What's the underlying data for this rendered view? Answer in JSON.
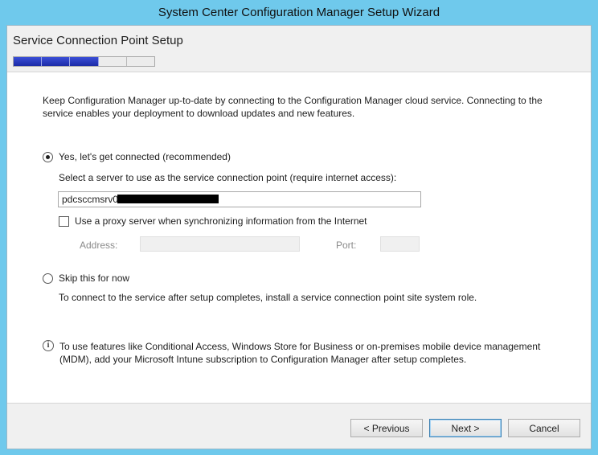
{
  "window": {
    "title": "System Center Configuration Manager Setup Wizard"
  },
  "header": {
    "title": "Service Connection Point Setup",
    "progress": {
      "completed_steps": 3,
      "total_steps": 5
    }
  },
  "main": {
    "intro": "Keep Configuration Manager up-to-date by connecting to the Configuration Manager cloud service. Connecting to the service enables your deployment to download updates and new features.",
    "option_connect": {
      "label": "Yes, let's get connected (recommended)",
      "selected": true,
      "server_prompt": "Select a server to use as the service connection point (require internet access):",
      "server_value": "pdcsccmsrv01",
      "proxy_label": "Use a proxy server when synchronizing information from the Internet",
      "proxy_checked": false,
      "address_label": "Address:",
      "port_label": "Port:"
    },
    "option_skip": {
      "label": "Skip this for now",
      "selected": false,
      "description": "To connect to the service after setup completes, install a service connection point site system role."
    },
    "info_text": "To use features like Conditional Access, Windows Store for Business or on-premises mobile device management (MDM), add your Microsoft Intune subscription to Configuration Manager after setup completes."
  },
  "footer": {
    "previous_label": "< Previous",
    "next_label": "Next >",
    "cancel_label": "Cancel"
  }
}
